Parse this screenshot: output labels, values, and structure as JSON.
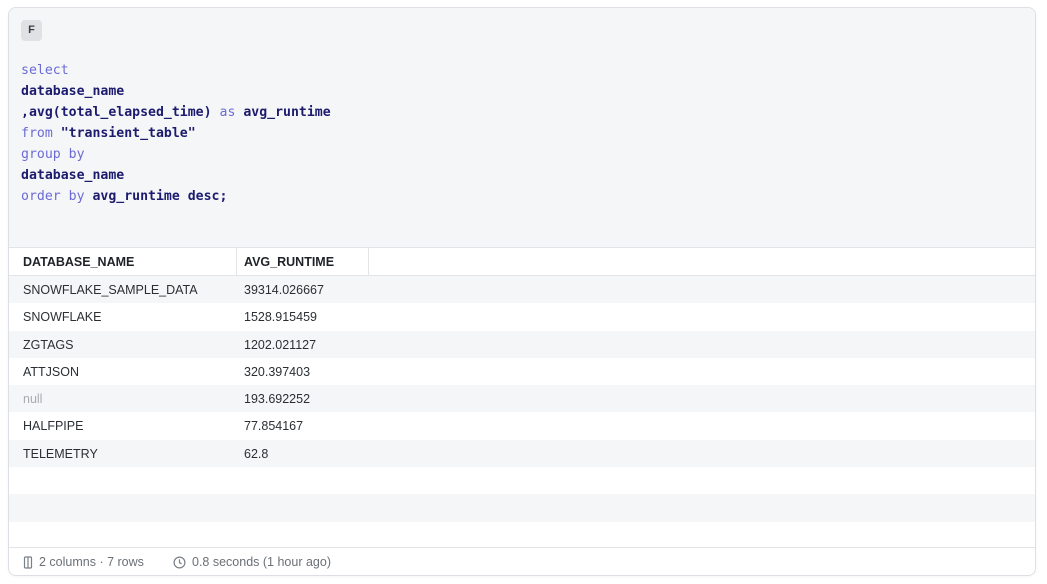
{
  "editor": {
    "badge": "F",
    "code_lines": [
      [
        {
          "t": "select",
          "c": "kw"
        }
      ],
      [
        {
          "t": "database_name",
          "c": "id"
        }
      ],
      [
        {
          "t": ",avg(total_elapsed_time) ",
          "c": "id"
        },
        {
          "t": "as",
          "c": "kw"
        },
        {
          "t": " avg_runtime",
          "c": "id"
        }
      ],
      [
        {
          "t": "from ",
          "c": "kw"
        },
        {
          "t": "\"transient_table\"",
          "c": "str"
        }
      ],
      [
        {
          "t": "group by",
          "c": "kw"
        }
      ],
      [
        {
          "t": "database_name",
          "c": "id"
        }
      ],
      [
        {
          "t": "order by ",
          "c": "kw"
        },
        {
          "t": "avg_runtime desc;",
          "c": "id"
        }
      ]
    ]
  },
  "results": {
    "columns": [
      "DATABASE_NAME",
      "AVG_RUNTIME"
    ],
    "rows": [
      [
        "SNOWFLAKE_SAMPLE_DATA",
        "39314.026667"
      ],
      [
        "SNOWFLAKE",
        "1528.915459"
      ],
      [
        "ZGTAGS",
        "1202.021127"
      ],
      [
        "ATTJSON",
        "320.397403"
      ],
      [
        "null",
        "193.692252"
      ],
      [
        "HALFPIPE",
        "77.854167"
      ],
      [
        "TELEMETRY",
        "62.8"
      ]
    ],
    "empty_rows": 3
  },
  "footer": {
    "table_icon": "table-icon",
    "summary": "2 columns · 7 rows",
    "clock_icon": "clock-icon",
    "timing": "0.8 seconds (1 hour ago)"
  }
}
